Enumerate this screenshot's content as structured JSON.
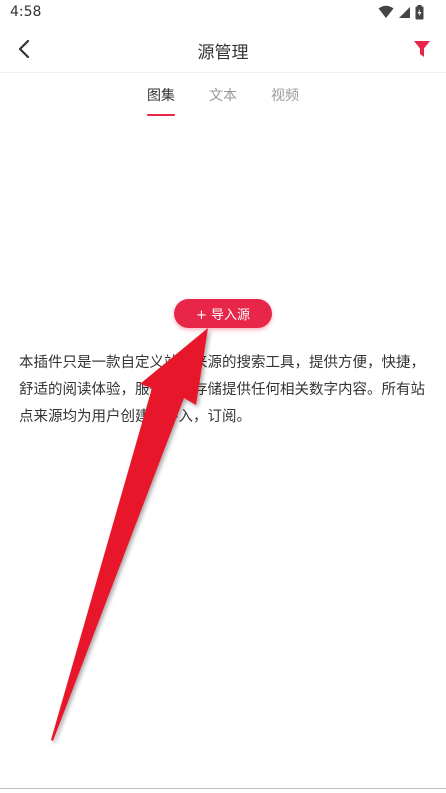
{
  "status": {
    "time": "4:58"
  },
  "appbar": {
    "title": "源管理"
  },
  "tabs": [
    {
      "label": "图集",
      "active": true
    },
    {
      "label": "文本",
      "active": false
    },
    {
      "label": "视频",
      "active": false
    }
  ],
  "main": {
    "import_button": "+ 导入源",
    "description": "本插件只是一款自定义站点来源的搜索工具，提供方便，快捷，舒适的阅读体验，服务器不存储提供任何相关数字内容。所有站点来源均为用户创建，导入，订阅。"
  },
  "colors": {
    "accent": "#e8264a"
  },
  "icons": [
    "wifi-icon",
    "signal-icon",
    "battery-icon",
    "back-icon",
    "filter-icon"
  ]
}
